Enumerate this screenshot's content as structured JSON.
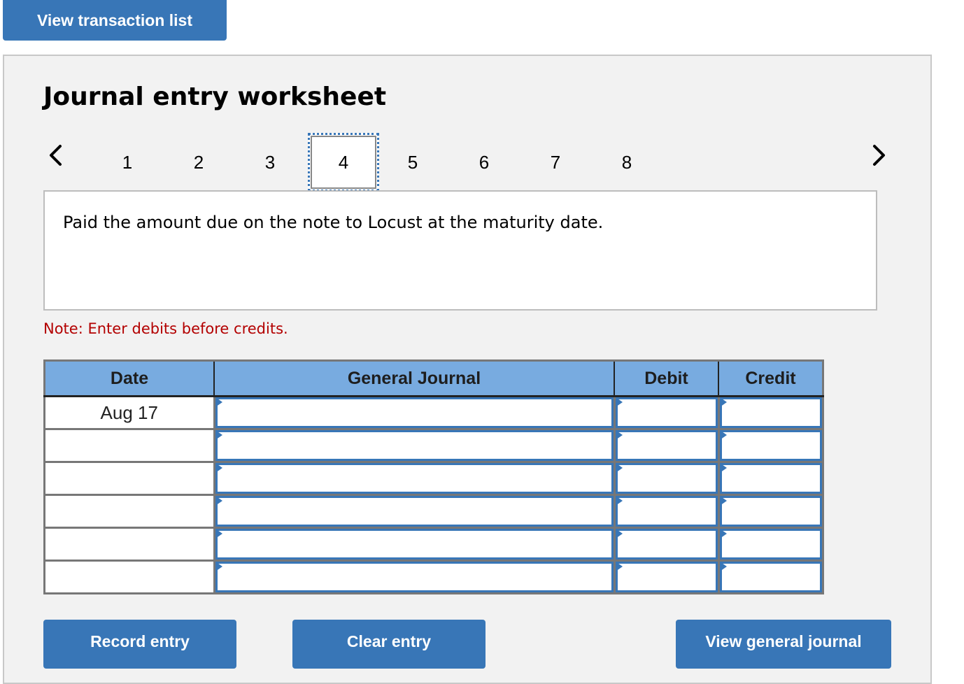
{
  "top_button": {
    "label": "View transaction list"
  },
  "worksheet": {
    "title": "Journal entry worksheet",
    "nav": {
      "prev_icon": "chevron-left-icon",
      "next_icon": "chevron-right-icon",
      "tabs": [
        "1",
        "2",
        "3",
        "4",
        "5",
        "6",
        "7",
        "8"
      ],
      "active_tab": "4"
    },
    "description": "Paid the amount due on the note to Locust at the maturity date.",
    "note": "Note: Enter debits before credits.",
    "table": {
      "headers": [
        "Date",
        "General Journal",
        "Debit",
        "Credit"
      ],
      "rows": [
        {
          "date": "Aug 17",
          "account": "",
          "debit": "",
          "credit": ""
        },
        {
          "date": "",
          "account": "",
          "debit": "",
          "credit": ""
        },
        {
          "date": "",
          "account": "",
          "debit": "",
          "credit": ""
        },
        {
          "date": "",
          "account": "",
          "debit": "",
          "credit": ""
        },
        {
          "date": "",
          "account": "",
          "debit": "",
          "credit": ""
        },
        {
          "date": "",
          "account": "",
          "debit": "",
          "credit": ""
        }
      ]
    },
    "buttons": {
      "record": "Record entry",
      "clear": "Clear entry",
      "view_journal": "View general journal"
    }
  },
  "colors": {
    "accent": "#3876b7",
    "header_bg": "#78abe0",
    "note": "#b30000",
    "panel_bg": "#f2f2f2"
  }
}
